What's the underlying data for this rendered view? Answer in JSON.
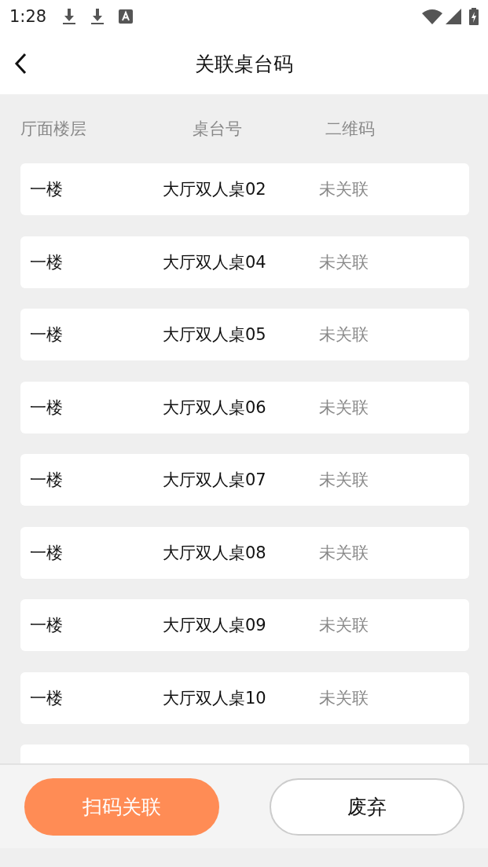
{
  "status_bar": {
    "time": "1:28"
  },
  "header": {
    "title": "关联桌台码"
  },
  "table": {
    "columns": [
      "厅面楼层",
      "桌台号",
      "二维码"
    ],
    "rows": [
      {
        "floor": "一楼",
        "table": "大厅双人桌02",
        "qr_status": "未关联"
      },
      {
        "floor": "一楼",
        "table": "大厅双人桌04",
        "qr_status": "未关联"
      },
      {
        "floor": "一楼",
        "table": "大厅双人桌05",
        "qr_status": "未关联"
      },
      {
        "floor": "一楼",
        "table": "大厅双人桌06",
        "qr_status": "未关联"
      },
      {
        "floor": "一楼",
        "table": "大厅双人桌07",
        "qr_status": "未关联"
      },
      {
        "floor": "一楼",
        "table": "大厅双人桌08",
        "qr_status": "未关联"
      },
      {
        "floor": "一楼",
        "table": "大厅双人桌09",
        "qr_status": "未关联"
      },
      {
        "floor": "一楼",
        "table": "大厅双人桌10",
        "qr_status": "未关联"
      }
    ]
  },
  "buttons": [
    {
      "label": "扫码关联",
      "kind": "primary"
    },
    {
      "label": "废弃",
      "kind": "secondary"
    }
  ]
}
